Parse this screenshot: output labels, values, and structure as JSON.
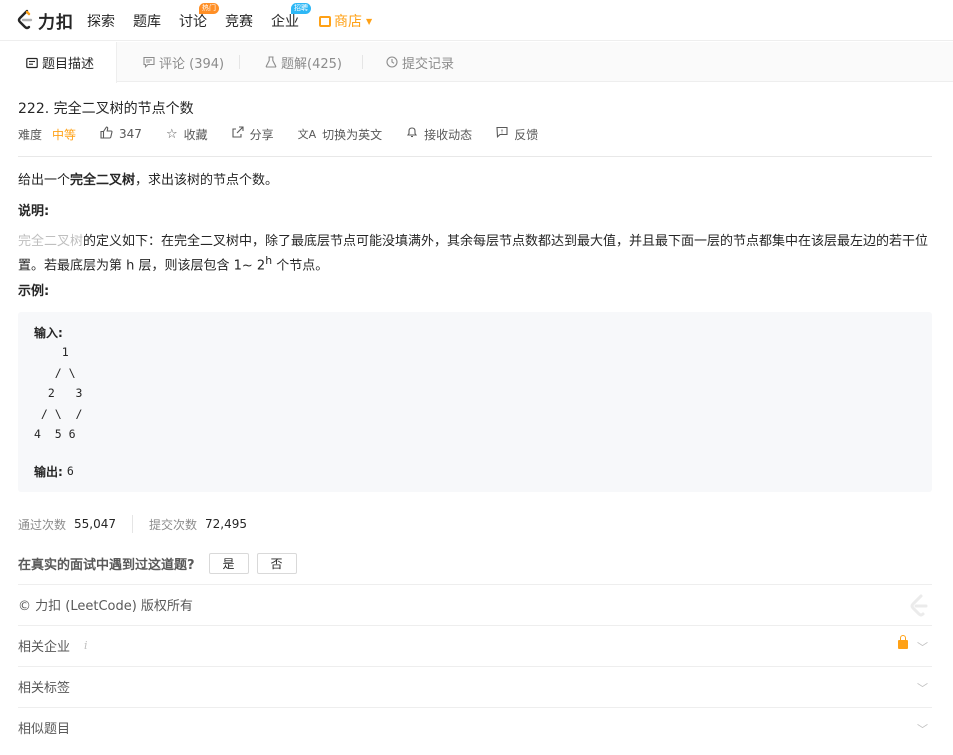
{
  "nav": {
    "logo_text": "力扣",
    "items": [
      "探索",
      "题库",
      "讨论",
      "竞赛",
      "企业"
    ],
    "discuss_badge": "热门",
    "company_badge": "招聘",
    "store_label": "商店"
  },
  "tabs": [
    {
      "label": "题目描述",
      "icon": "document-icon"
    },
    {
      "label": "评论 (394)",
      "icon": "comment-icon"
    },
    {
      "label": "题解(425)",
      "icon": "flask-icon"
    },
    {
      "label": "提交记录",
      "icon": "clock-icon"
    }
  ],
  "problem": {
    "title": "222. 完全二叉树的节点个数",
    "difficulty_label": "难度",
    "difficulty_value": "中等",
    "likes": "347",
    "collect": "收藏",
    "share": "分享",
    "switch_lang": "切换为英文",
    "subscribe": "接收动态",
    "feedback": "反馈"
  },
  "description": {
    "line1_pre": "给出一个",
    "line1_bold": "完全二叉树",
    "line1_post": "，求出该树的节点个数。",
    "heading_note": "说明:",
    "note_link": "完全二叉树",
    "note_line1": "的定义如下：在完全二叉树中，除了最底层节点可能没填满外，其余每层节点数都达到最大值，并且最下面一层的节点都集中在该层最左边的若干位",
    "note_line2_pre": "置。若最底层为第 h 层，则该层包含 1~ 2",
    "note_line2_sup": "h",
    "note_line2_post": " 个节点。",
    "heading_example": "示例:"
  },
  "example": {
    "input_label": "输入:",
    "tree": "    1\n   / \\\n  2   3\n / \\  /\n4  5 6",
    "output_label": "输出:",
    "output_value": "6"
  },
  "stats": {
    "accepted_label": "通过次数",
    "accepted_value": "55,047",
    "submitted_label": "提交次数",
    "submitted_value": "72,495"
  },
  "interview": {
    "question": "在真实的面试中遇到过这道题?",
    "yes": "是",
    "no": "否"
  },
  "footer": {
    "copyright": "© 力扣 (LeetCode) 版权所有",
    "related_companies": "相关企业",
    "info_mark": "i",
    "related_tags": "相关标签",
    "similar_problems": "相似题目"
  },
  "colors": {
    "accent": "#ffa116",
    "hot_badge": "#ff8f26",
    "hire_badge": "#2db7f5"
  }
}
